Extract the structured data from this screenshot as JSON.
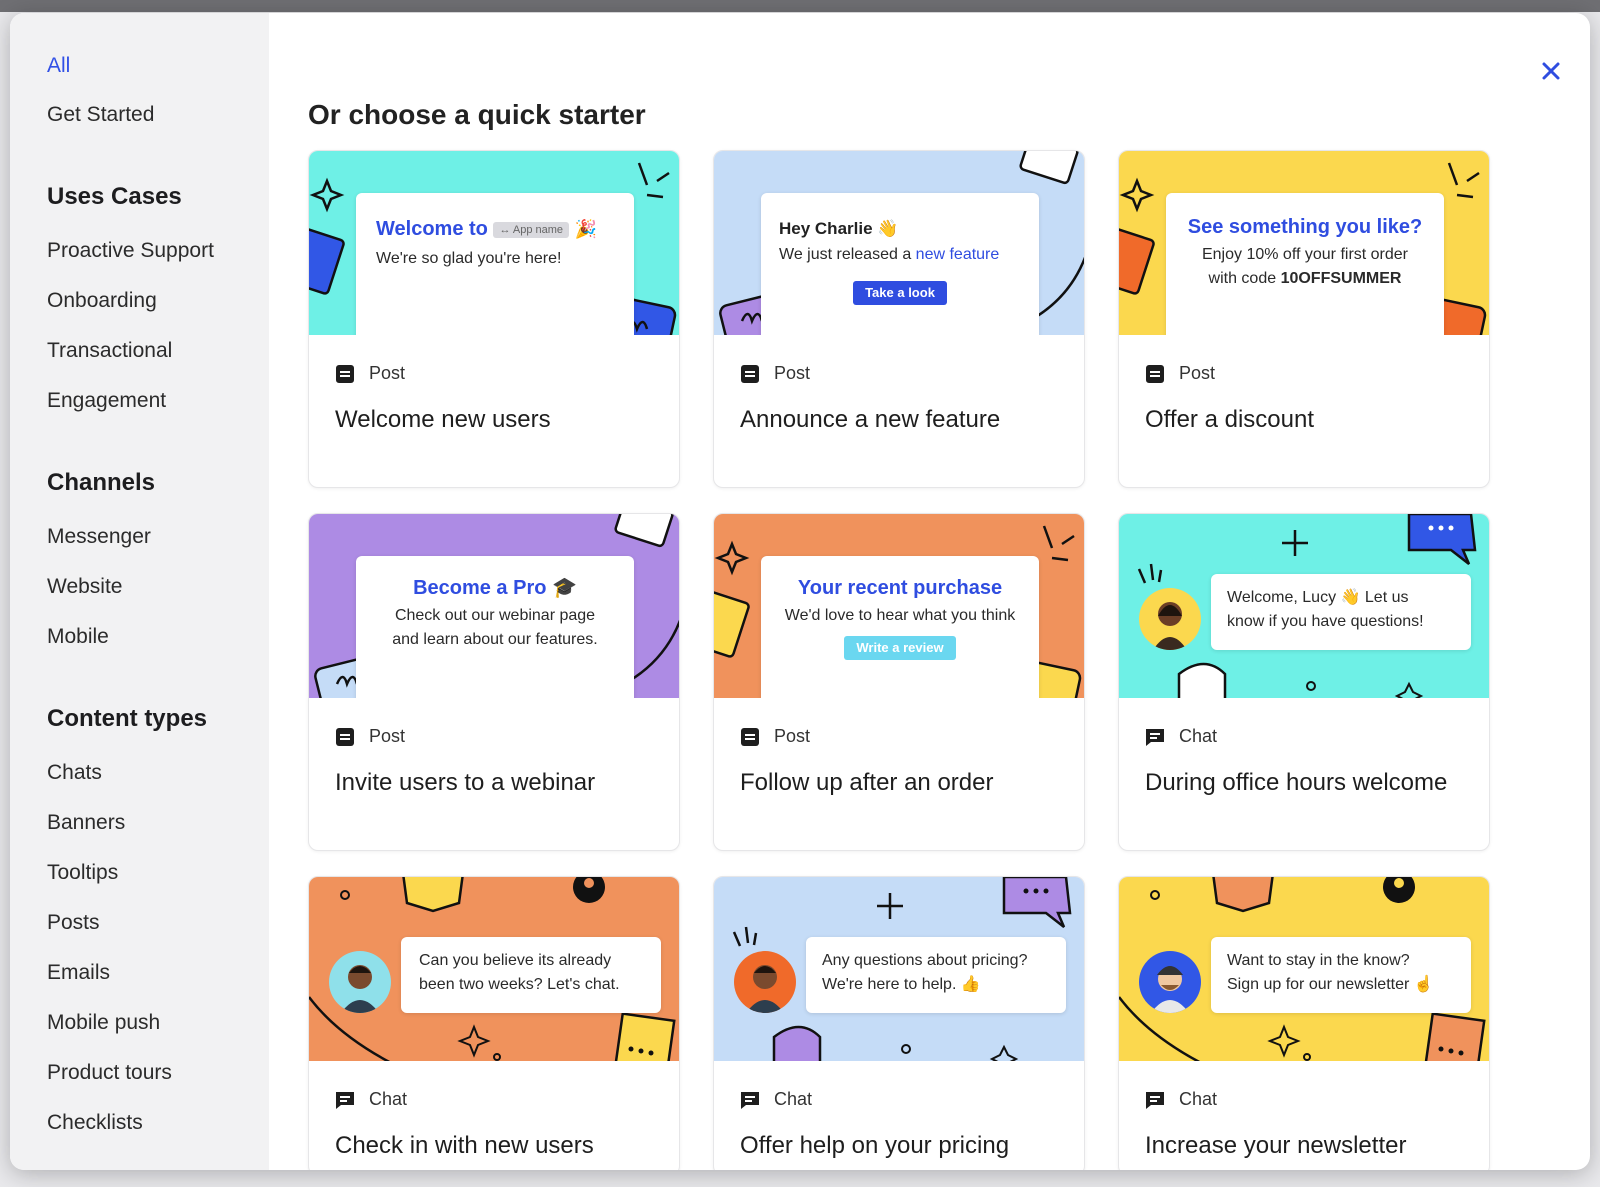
{
  "sidebar": {
    "top_items": [
      {
        "label": "All",
        "active": true
      },
      {
        "label": "Get Started",
        "active": false
      }
    ],
    "sections": [
      {
        "heading": "Uses Cases",
        "items": [
          "Proactive Support",
          "Onboarding",
          "Transactional",
          "Engagement"
        ]
      },
      {
        "heading": "Channels",
        "items": [
          "Messenger",
          "Website",
          "Mobile"
        ]
      },
      {
        "heading": "Content types",
        "items": [
          "Chats",
          "Banners",
          "Tooltips",
          "Posts",
          "Emails",
          "Mobile push",
          "Product tours",
          "Checklists"
        ]
      }
    ]
  },
  "main": {
    "title": "Or choose a quick starter",
    "close_icon": "close-icon"
  },
  "colors": {
    "accent": "#2f4de0",
    "cyan": "#6ef0e6",
    "lightblue": "#c5dcf7",
    "yellow": "#fbd84e",
    "purple": "#ad8be4",
    "orange": "#f0925c"
  },
  "cards": [
    {
      "type": "Post",
      "title": "Welcome new users",
      "art": {
        "heading": "Welcome to",
        "pill": "↔ App name",
        "line1": "We're so glad you're here!"
      }
    },
    {
      "type": "Post",
      "title": "Announce a new feature",
      "art": {
        "heading": "Hey Charlie 👋",
        "line1_prefix": "We just released a ",
        "line1_link": "new feature",
        "button": "Take a look"
      }
    },
    {
      "type": "Post",
      "title": "Offer a discount",
      "art": {
        "heading": "See something you like?",
        "line1": "Enjoy 10% off your first order",
        "line2_prefix": "with code ",
        "line2_code": "10OFFSUMMER"
      }
    },
    {
      "type": "Post",
      "title": "Invite users to a webinar",
      "art": {
        "heading": "Become a Pro 🎓",
        "line1": "Check out our webinar page",
        "line2": "and learn about our features."
      }
    },
    {
      "type": "Post",
      "title": "Follow up after an order",
      "art": {
        "heading": "Your recent purchase",
        "line1": "We'd love to hear what you think",
        "button": "Write a review"
      }
    },
    {
      "type": "Chat",
      "title": "During office hours welcome",
      "art": {
        "line1": "Welcome, Lucy 👋 Let us",
        "line2": "know if you have questions!"
      }
    },
    {
      "type": "Chat",
      "title": "Check in with new users",
      "art": {
        "line1": "Can you believe its already",
        "line2": "been two weeks? Let's chat."
      }
    },
    {
      "type": "Chat",
      "title": "Offer help on your pricing",
      "art": {
        "line1": "Any questions about pricing?",
        "line2": "We're here to help. 👍"
      }
    },
    {
      "type": "Chat",
      "title": "Increase your newsletter",
      "art": {
        "line1": "Want to stay in the know?",
        "line2": "Sign up for our newsletter ☝"
      }
    }
  ]
}
